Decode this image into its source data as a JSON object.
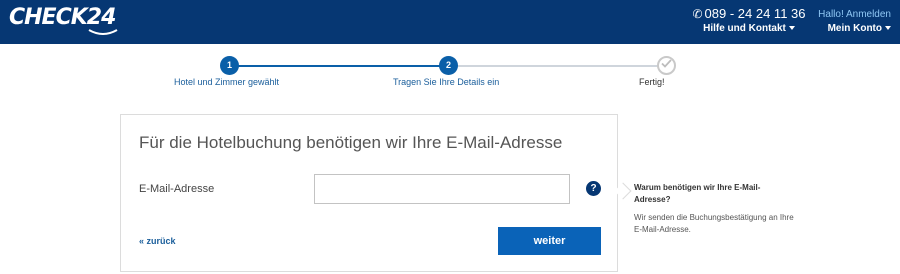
{
  "header": {
    "logo_text": "CHECK24",
    "phone_icon": "phone-icon",
    "phone_number": "089 - 24 24 11 36",
    "help_label": "Hilfe und Kontakt",
    "hello_label": "Hallo! Anmelden",
    "account_label": "Mein Konto"
  },
  "progress": {
    "steps": [
      {
        "number": "1",
        "label": "Hotel und Zimmer gewählt",
        "state": "done"
      },
      {
        "number": "2",
        "label": "Tragen Sie Ihre Details ein",
        "state": "current"
      },
      {
        "number": "",
        "label": "Fertig!",
        "state": "pending"
      }
    ]
  },
  "form": {
    "title": "Für die Hotelbuchung benötigen wir Ihre E-Mail-Adresse",
    "email_label": "E-Mail-Adresse",
    "email_value": "",
    "email_placeholder": "",
    "help_icon": "question-icon",
    "back_label": "« zurück",
    "next_label": "weiter"
  },
  "info": {
    "title": "Warum benötigen wir Ihre E-Mail-Adresse?",
    "text": "Wir senden die Buchungsbestätigung an Ihre E-Mail-Adresse."
  },
  "colors": {
    "header_bg": "#063773",
    "accent": "#0a63b8",
    "link": "#1a5e9b"
  }
}
